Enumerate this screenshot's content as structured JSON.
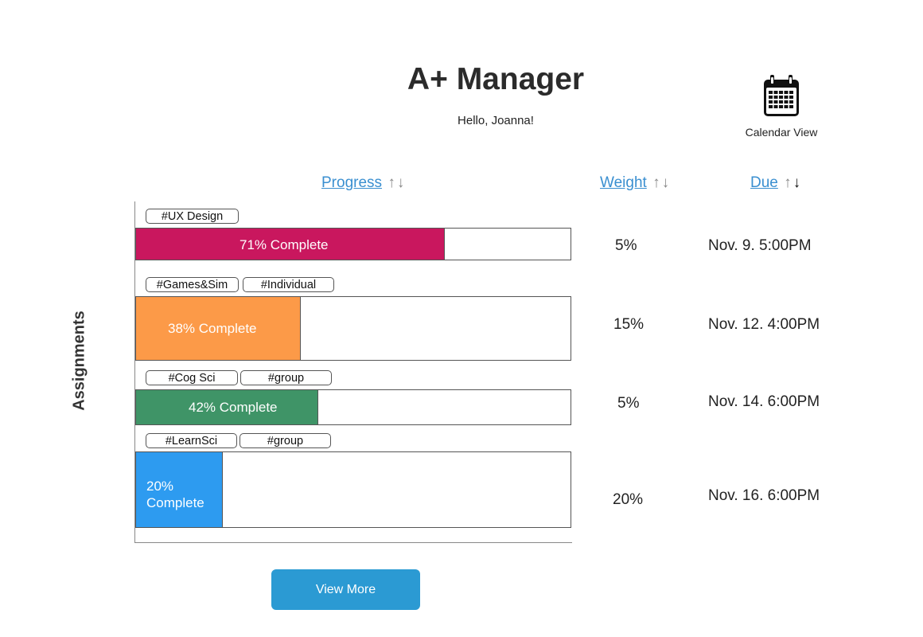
{
  "header": {
    "title": "A+ Manager",
    "greeting": "Hello, Joanna!"
  },
  "calendar": {
    "label": "Calendar View",
    "icon": "calendar-icon"
  },
  "columns": {
    "progress": {
      "label": "Progress",
      "up": "↑",
      "down": "↓"
    },
    "weight": {
      "label": "Weight",
      "up": "↑",
      "down": "↓"
    },
    "due": {
      "label": "Due",
      "up": "↑",
      "down": "↓",
      "active": "down"
    }
  },
  "axis_label": "Assignments",
  "assignments": [
    {
      "tags": [
        "#UX Design"
      ],
      "progress": 71,
      "label": "71% Complete",
      "color": "#c9175e",
      "weight": "5%",
      "due": "Nov. 9. 5:00PM"
    },
    {
      "tags": [
        "#Games&Sim",
        "#Individual"
      ],
      "progress": 38,
      "label": "38% Complete",
      "color": "#fc9a48",
      "weight": "15%",
      "due": "Nov. 12. 4:00PM"
    },
    {
      "tags": [
        "#Cog Sci",
        "#group"
      ],
      "progress": 42,
      "label": "42% Complete",
      "color": "#3f9467",
      "weight": "5%",
      "due": "Nov. 14. 6:00PM"
    },
    {
      "tags": [
        "#LearnSci",
        "#group"
      ],
      "progress": 20,
      "label": "20% Complete",
      "label_lines": [
        "20%",
        "Complete"
      ],
      "color": "#2d9bf0",
      "weight": "20%",
      "due": "Nov. 16. 6:00PM"
    }
  ],
  "view_more_label": "View More"
}
